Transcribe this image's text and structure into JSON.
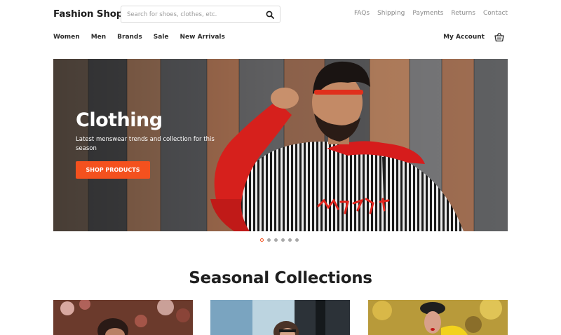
{
  "brand": {
    "name": "Fashion Shop"
  },
  "search": {
    "placeholder": "Search for shoes, clothes, etc.",
    "value": "",
    "icon": "search-icon"
  },
  "utility_links": [
    "FAQs",
    "Shipping",
    "Payments",
    "Returns",
    "Contact"
  ],
  "nav": {
    "items": [
      "Women",
      "Men",
      "Brands",
      "Sale",
      "New Arrivals"
    ],
    "account_label": "My Account",
    "cart_icon": "basket-icon"
  },
  "hero": {
    "title": "Clothing",
    "subtitle": "Latest menswear trends and collection for this season",
    "button_label": "SHOP PRODUCTS",
    "slide_count": 6,
    "active_slide": 1
  },
  "section": {
    "title": "Seasonal Collections"
  },
  "colors": {
    "accent": "#f4511e",
    "text": "#222222",
    "muted": "#8a8a8a"
  }
}
